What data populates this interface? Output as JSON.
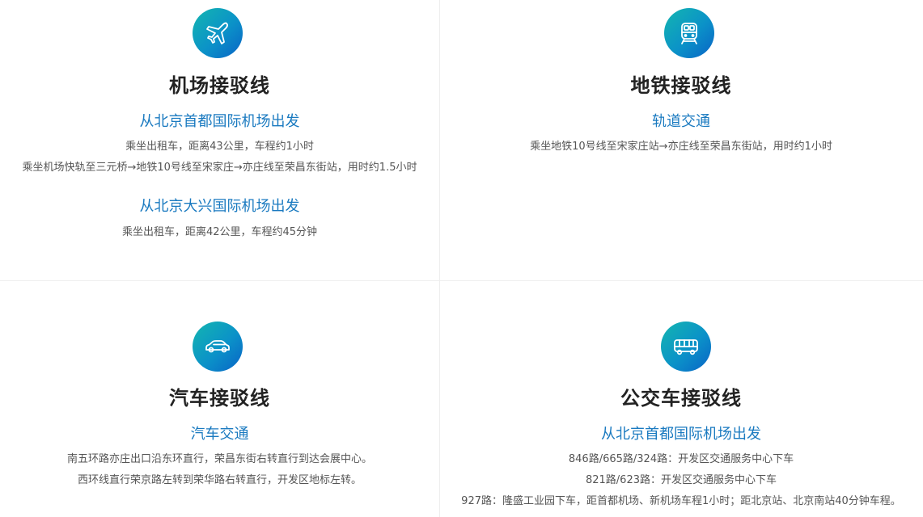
{
  "sections": {
    "airport": {
      "icon": "airplane-icon",
      "title": "机场接驳线",
      "groups": [
        {
          "subtitle": "从北京首都国际机场出发",
          "lines": [
            "乘坐出租车，距离43公里，车程约1小时",
            "乘坐机场快轨至三元桥→地铁10号线至宋家庄→亦庄线至荣昌东街站，用时约1.5小时"
          ]
        },
        {
          "subtitle": "从北京大兴国际机场出发",
          "lines": [
            "乘坐出租车，距离42公里，车程约45分钟"
          ]
        }
      ]
    },
    "subway": {
      "icon": "train-icon",
      "title": "地铁接驳线",
      "subtitle": "轨道交通",
      "lines": [
        "乘坐地铁10号线至宋家庄站→亦庄线至荣昌东街站，用时约1小时"
      ]
    },
    "car": {
      "icon": "car-icon",
      "title": "汽车接驳线",
      "subtitle": "汽车交通",
      "lines": [
        "南五环路亦庄出口沿东环直行，荣昌东街右转直行到达会展中心。",
        "西环线直行荣京路左转到荣华路右转直行，开发区地标左转。"
      ]
    },
    "bus": {
      "icon": "bus-icon",
      "title": "公交车接驳线",
      "subtitle": "从北京首都国际机场出发",
      "lines": [
        "846路/665路/324路：开发区交通服务中心下车",
        "821路/623路：开发区交通服务中心下车",
        "927路：隆盛工业园下车，距首都机场、新机场车程1小时；距北京站、北京南站40分钟车程。"
      ]
    }
  }
}
